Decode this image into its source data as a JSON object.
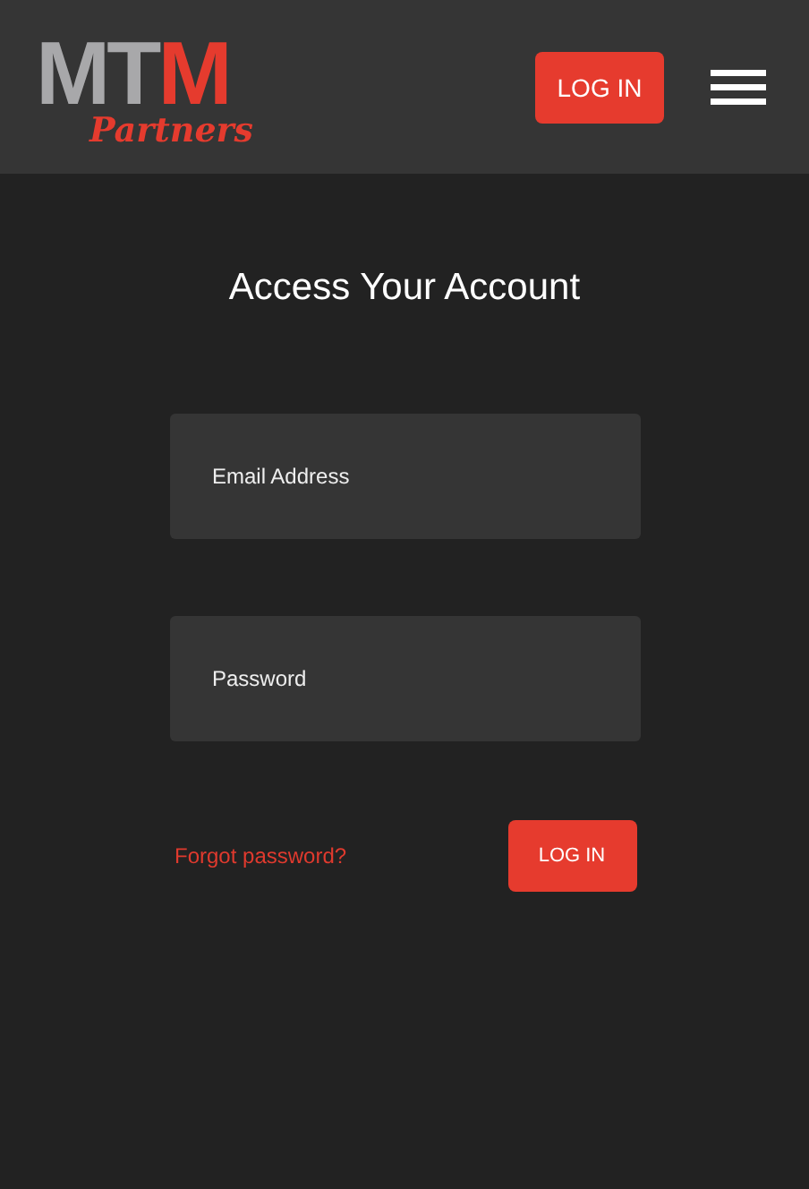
{
  "header": {
    "logo": {
      "wordmark": [
        {
          "text": "MT",
          "color": "#a8a8aa"
        },
        {
          "text": "M",
          "color": "#e53b2e"
        }
      ],
      "tagline": "Partners"
    },
    "login_button": "LOG IN"
  },
  "form": {
    "title": "Access Your Account",
    "fields": [
      {
        "placeholder": "Email Address"
      },
      {
        "placeholder": "Password"
      }
    ],
    "forgot_link": "Forgot password?",
    "submit_button": "LOG IN"
  }
}
